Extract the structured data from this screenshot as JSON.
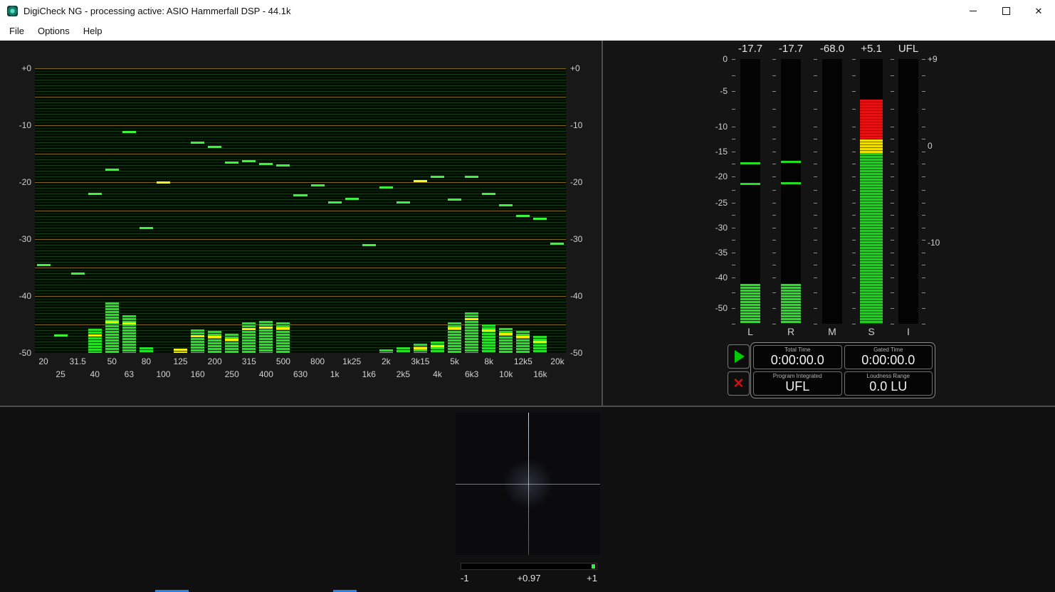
{
  "window": {
    "title": "DigiCheck NG - processing active: ASIO Hammerfall DSP - 44.1k",
    "close": "✕"
  },
  "menu": {
    "items": [
      {
        "label": "File"
      },
      {
        "label": "Options"
      },
      {
        "label": "Help"
      }
    ]
  },
  "spectrum": {
    "db_scale": [
      {
        "label": "+0",
        "db": 0
      },
      {
        "label": "-10",
        "db": -10
      },
      {
        "label": "-20",
        "db": -20
      },
      {
        "label": "-30",
        "db": -30
      },
      {
        "label": "-40",
        "db": -40
      },
      {
        "label": "-50",
        "db": -50
      }
    ],
    "db_min": -50,
    "db_max": 0,
    "bands": [
      {
        "freq": "20",
        "peak": -34.4
      },
      {
        "freq": "25",
        "peak": -46.8
      },
      {
        "freq": "31.5",
        "peak": -35.9
      },
      {
        "freq": "40",
        "peak": -21.9,
        "bar": -45.8,
        "avg": -46.8
      },
      {
        "freq": "50",
        "peak": -17.6,
        "bar": -41.1,
        "avg": -44.4
      },
      {
        "freq": "63",
        "peak": -11.0,
        "bar": -43.4,
        "avg": -44.6
      },
      {
        "freq": "80",
        "peak": -27.9,
        "bar": -49.0
      },
      {
        "freq": "100",
        "peak": -19.9,
        "peak_color": "yellow"
      },
      {
        "freq": "125",
        "peak": -49.2,
        "bar": -49.2,
        "peak_color": "yellow",
        "bar_color": "yellow"
      },
      {
        "freq": "160",
        "peak": -12.9,
        "bar": -45.9,
        "avg": -46.9
      },
      {
        "freq": "200",
        "peak": -13.6,
        "bar": -46.1,
        "avg": -47.0
      },
      {
        "freq": "250",
        "peak": -16.4,
        "bar": -46.6,
        "avg": -47.5
      },
      {
        "freq": "315",
        "peak": -16.1,
        "bar": -44.6,
        "avg": -45.6
      },
      {
        "freq": "400",
        "peak": -16.6,
        "bar": -44.4,
        "avg": -45.4
      },
      {
        "freq": "500",
        "peak": -16.9,
        "bar": -44.6,
        "avg": -45.5
      },
      {
        "freq": "630",
        "peak": -22.1
      },
      {
        "freq": "800",
        "peak": -20.4
      },
      {
        "freq": "1k",
        "peak": -23.4
      },
      {
        "freq": "1k25",
        "peak": -22.7
      },
      {
        "freq": "1k6",
        "peak": -30.9
      },
      {
        "freq": "2k",
        "peak": -20.8,
        "bar": -49.4
      },
      {
        "freq": "2k5",
        "peak": -23.4,
        "bar": -49.0
      },
      {
        "freq": "3k15",
        "peak": -19.6,
        "bar": -48.4,
        "avg": -49.0,
        "peak_color": "yellow"
      },
      {
        "freq": "4k",
        "peak": -18.9,
        "bar": -48.0,
        "avg": -48.6
      },
      {
        "freq": "5k",
        "peak": -22.9,
        "bar": -44.6,
        "avg": -45.5
      },
      {
        "freq": "6k3",
        "peak": -18.9,
        "bar": -42.9,
        "avg": -43.9
      },
      {
        "freq": "8k",
        "peak": -21.9,
        "bar": -45.0,
        "avg": -45.9
      },
      {
        "freq": "10k",
        "peak": -23.9,
        "bar": -45.6,
        "avg": -46.5
      },
      {
        "freq": "12k5",
        "peak": -25.7,
        "bar": -46.1,
        "avg": -47.0
      },
      {
        "freq": "16k",
        "peak": -26.2,
        "bar": -47.0,
        "avg": -47.9
      },
      {
        "freq": "20k",
        "peak": -30.6
      }
    ]
  },
  "meters": {
    "readouts": [
      "-17.7",
      "-17.7",
      "-68.0",
      "+5.1",
      "UFL"
    ],
    "channel_labels": [
      "L",
      "R",
      "M",
      "S",
      "I"
    ],
    "left_scale": [
      {
        "label": "0",
        "pos": 0.0
      },
      {
        "label": "-5",
        "pos": 0.121
      },
      {
        "label": "-10",
        "pos": 0.255
      },
      {
        "label": "-15",
        "pos": 0.349
      },
      {
        "label": "-20",
        "pos": 0.444
      },
      {
        "label": "-25",
        "pos": 0.543
      },
      {
        "label": "-30",
        "pos": 0.637
      },
      {
        "label": "-35",
        "pos": 0.731
      },
      {
        "label": "-40",
        "pos": 0.825
      },
      {
        "label": "-50",
        "pos": 0.941
      }
    ],
    "right_scale": [
      {
        "label": "+9",
        "pos": 0.0
      },
      {
        "label": "0",
        "pos": 0.328
      },
      {
        "label": "-10",
        "pos": 0.694
      }
    ],
    "bars": [
      {
        "name": "L",
        "peaks": [
          0.39,
          0.468
        ],
        "bar_from": 0.85
      },
      {
        "name": "R",
        "peaks": [
          0.385,
          0.465
        ],
        "bar_from": 0.85
      },
      {
        "name": "M"
      },
      {
        "name": "S",
        "segments": [
          {
            "color": "#e81010",
            "from": 0.153,
            "to": 0.304
          },
          {
            "color": "#f0df00",
            "from": 0.304,
            "to": 0.356
          },
          {
            "color": "#17d417",
            "from": 0.356,
            "to": 1.0
          }
        ]
      },
      {
        "name": "I"
      }
    ]
  },
  "transport": {
    "clear_glyph": "✕"
  },
  "loudness": {
    "cells": [
      {
        "label": "Total Time",
        "value": "0:00:00.0"
      },
      {
        "label": "Gated Time",
        "value": "0:00:00.0"
      },
      {
        "label": "Program Integrated",
        "value": "UFL"
      },
      {
        "label": "Loudness Range",
        "value": "0.0 LU"
      }
    ]
  },
  "vectorscope": {
    "correlation": {
      "min": "-1",
      "value": "+0.97",
      "max": "+1",
      "position": 0.985
    }
  },
  "colors": {
    "green": "#22dd22",
    "yellow": "#f2f200",
    "red": "#e81010"
  }
}
